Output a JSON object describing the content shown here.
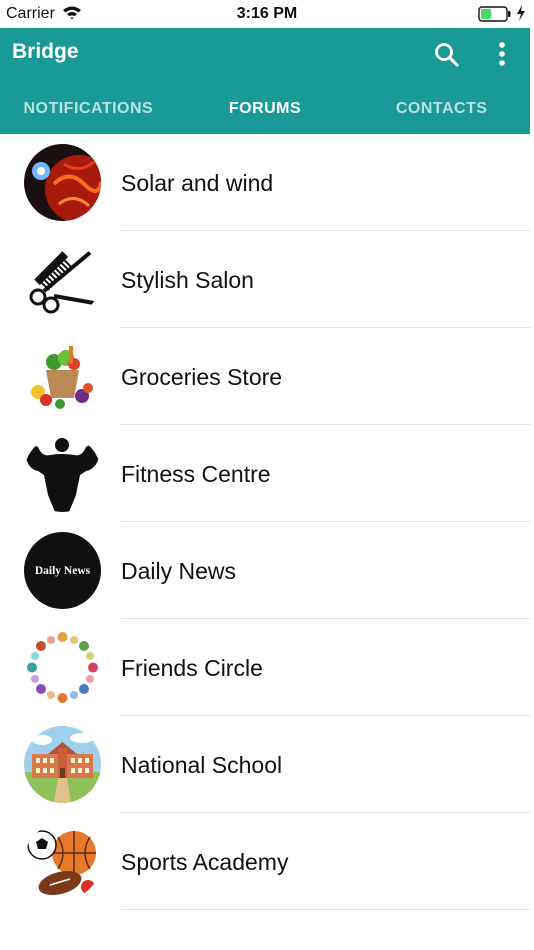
{
  "status_bar": {
    "carrier": "Carrier",
    "time": "3:16 PM",
    "icons": [
      "wifi-icon",
      "battery-icon",
      "charging-bolt-icon"
    ]
  },
  "app_bar": {
    "title": "Bridge",
    "background_color": "#1a9a96",
    "actions": [
      "search-icon",
      "more-vertical-icon"
    ]
  },
  "tabs": [
    {
      "label": "NOTIFICATIONS",
      "active": false
    },
    {
      "label": "FORUMS",
      "active": true
    },
    {
      "label": "CONTACTS",
      "active": false
    }
  ],
  "forums": [
    {
      "name": "Solar and wind",
      "avatar": "solar-wind-avatar"
    },
    {
      "name": "Stylish Salon",
      "avatar": "salon-scissors-comb-avatar"
    },
    {
      "name": "Groceries Store",
      "avatar": "grocery-basket-avatar"
    },
    {
      "name": "Fitness Centre",
      "avatar": "bodybuilder-silhouette-avatar"
    },
    {
      "name": "Daily News",
      "avatar": "daily-news-avatar",
      "avatar_text": "Daily News"
    },
    {
      "name": "Friends Circle",
      "avatar": "friends-circle-avatar"
    },
    {
      "name": "National School",
      "avatar": "school-building-avatar"
    },
    {
      "name": "Sports Academy",
      "avatar": "sports-balls-avatar"
    }
  ]
}
